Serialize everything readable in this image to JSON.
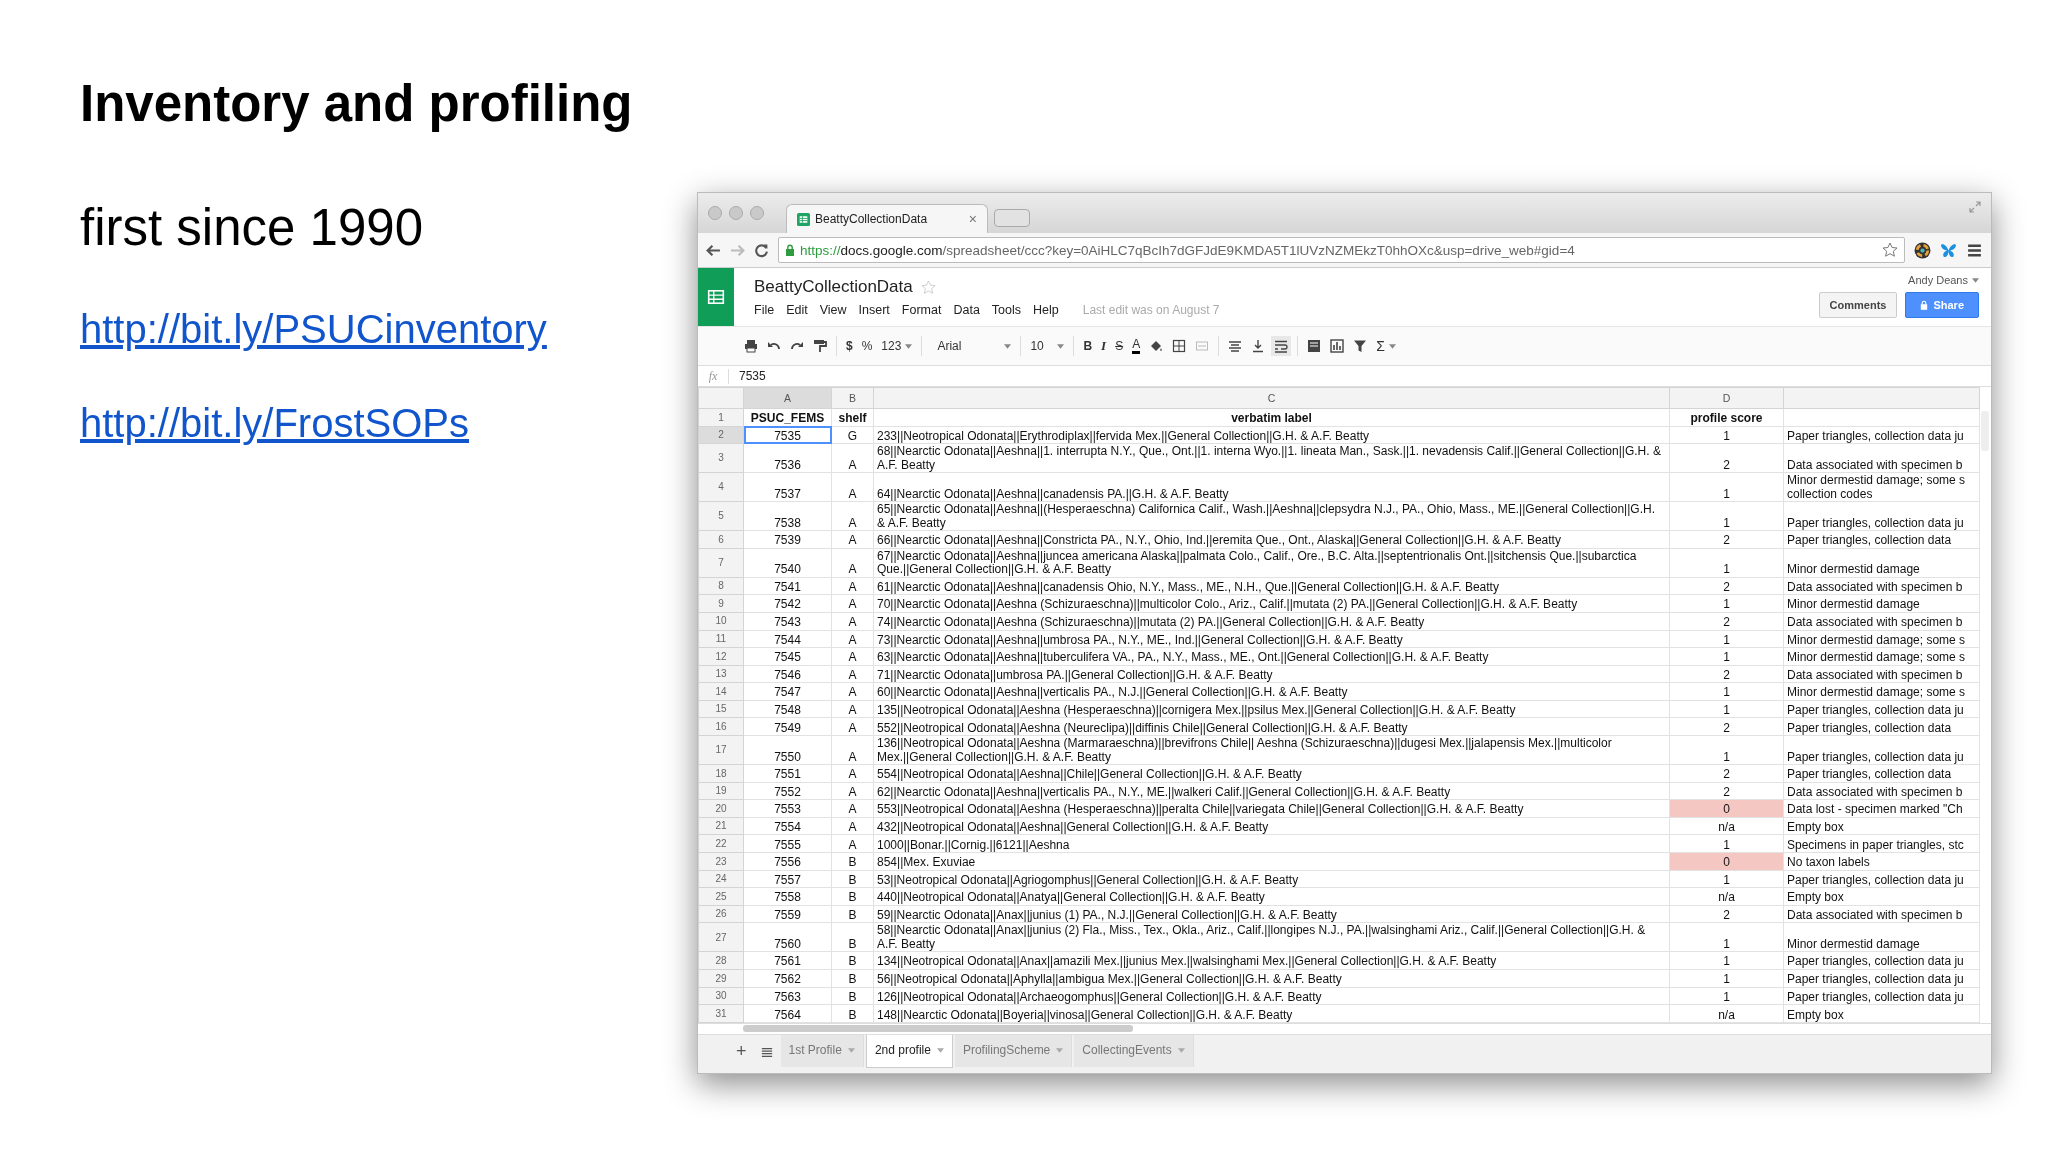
{
  "slide": {
    "title": "Inventory and profiling",
    "subtitle": "first since 1990",
    "links": [
      "http://bit.ly/PSUCinventory",
      "http://bit.ly/FrostSOPs"
    ]
  },
  "browser": {
    "tab_title": "BeattyCollectionData",
    "tab_close": "×",
    "url": {
      "scheme": "https://",
      "host": "docs.google.com",
      "path": "/spreadsheet/ccc?key=0AiHLC7qBcIh7dGFJdE9KMDA5T1lUVzNZMEkzT0hhOXc&usp=drive_web#gid=4"
    }
  },
  "doc": {
    "title": "BeattyCollectionData",
    "menus": [
      "File",
      "Edit",
      "View",
      "Insert",
      "Format",
      "Data",
      "Tools",
      "Help"
    ],
    "last_edit": "Last edit was on August 7",
    "user": "Andy Deans",
    "comments": "Comments",
    "share": "Share"
  },
  "toolbar": {
    "currency": "$",
    "percent": "%",
    "number_format": "123",
    "font": "Arial",
    "font_size": "10",
    "bold": "B",
    "italic": "I",
    "strike": "S",
    "text_color": "A",
    "sum": "Σ"
  },
  "formula_bar": {
    "label": "fx",
    "value": "7535"
  },
  "columns": [
    "A",
    "B",
    "C",
    "D"
  ],
  "header_row": {
    "number": "1",
    "a": "PSUC_FEMS",
    "b": "shelf",
    "c": "verbatim label",
    "d": "profile score"
  },
  "rows": [
    {
      "number": "2",
      "a": "7535",
      "b": "G",
      "c": "233||Neotropical Odonata||Erythrodiplax||fervida Mex.||General Collection||G.H. & A.F. Beatty",
      "d": "1",
      "e": "Paper triangles, collection data ju",
      "flagged": false,
      "selected": true
    },
    {
      "number": "3",
      "a": "7536",
      "b": "A",
      "c": "68||Nearctic Odonata||Aeshna||1. interrupta N.Y., Que., Ont.||1. interna Wyo.||1. lineata Man., Sask.||1. nevadensis Calif.||General Collection||G.H. & A.F. Beatty",
      "d": "2",
      "e": "Data associated with specimen b",
      "flagged": false,
      "selected": false
    },
    {
      "number": "4",
      "a": "7537",
      "b": "A",
      "c": "64||Nearctic Odonata||Aeshna||canadensis PA.||G.H. & A.F. Beatty",
      "d": "1",
      "e": "Minor dermestid damage; some s\ncollection codes",
      "flagged": false,
      "selected": false
    },
    {
      "number": "5",
      "a": "7538",
      "b": "A",
      "c": "65||Nearctic Odonata||Aeshna||(Hesperaeschna) Californica Calif., Wash.||Aeshna||clepsydra N.J., PA., Ohio, Mass., ME.||General Collection||G.H. & A.F. Beatty",
      "d": "1",
      "e": "Paper triangles, collection data ju",
      "flagged": false,
      "selected": false
    },
    {
      "number": "6",
      "a": "7539",
      "b": "A",
      "c": "66||Nearctic Odonata||Aeshna||Constricta PA., N.Y., Ohio, Ind.||eremita Que., Ont., Alaska||General Collection||G.H. & A.F. Beatty",
      "d": "2",
      "e": "Paper triangles, collection data",
      "flagged": false,
      "selected": false
    },
    {
      "number": "7",
      "a": "7540",
      "b": "A",
      "c": "67||Nearctic Odonata||Aeshna||juncea americana Alaska||palmata Colo., Calif., Ore., B.C. Alta.||septentrionalis Ont.||sitchensis Que.||subarctica Que.||General Collection||G.H. & A.F. Beatty",
      "d": "1",
      "e": "Minor dermestid damage",
      "flagged": false,
      "selected": false
    },
    {
      "number": "8",
      "a": "7541",
      "b": "A",
      "c": "61||Nearctic Odonata||Aeshna||canadensis Ohio, N.Y., Mass., ME., N.H., Que.||General Collection||G.H. & A.F. Beatty",
      "d": "2",
      "e": "Data associated with specimen b",
      "flagged": false,
      "selected": false
    },
    {
      "number": "9",
      "a": "7542",
      "b": "A",
      "c": "70||Nearctic Odonata||Aeshna (Schizuraeschna)||multicolor Colo., Ariz., Calif.||mutata (2) PA.||General Collection||G.H. & A.F. Beatty",
      "d": "1",
      "e": "Minor dermestid damage",
      "flagged": false,
      "selected": false
    },
    {
      "number": "10",
      "a": "7543",
      "b": "A",
      "c": "74||Nearctic Odonata||Aeshna (Schizuraeschna)||mutata (2) PA.||General Collection||G.H. & A.F. Beatty",
      "d": "2",
      "e": "Data associated with specimen b",
      "flagged": false,
      "selected": false
    },
    {
      "number": "11",
      "a": "7544",
      "b": "A",
      "c": "73||Nearctic Odonata||Aeshna||umbrosa PA., N.Y., ME., Ind.||General Collection||G.H. & A.F. Beatty",
      "d": "1",
      "e": "Minor dermestid damage; some s",
      "flagged": false,
      "selected": false
    },
    {
      "number": "12",
      "a": "7545",
      "b": "A",
      "c": "63||Nearctic Odonata||Aeshna||tuberculifera VA., PA., N.Y., Mass., ME., Ont.||General Collection||G.H. & A.F. Beatty",
      "d": "1",
      "e": "Minor dermestid damage; some s",
      "flagged": false,
      "selected": false
    },
    {
      "number": "13",
      "a": "7546",
      "b": "A",
      "c": "71||Nearctic Odonata||umbrosa PA.||General Collection||G.H. & A.F. Beatty",
      "d": "2",
      "e": "Data associated with specimen b",
      "flagged": false,
      "selected": false
    },
    {
      "number": "14",
      "a": "7547",
      "b": "A",
      "c": "60||Nearctic Odonata||Aeshna||verticalis PA., N.J.||General Collection||G.H. & A.F. Beatty",
      "d": "1",
      "e": "Minor dermestid damage; some s",
      "flagged": false,
      "selected": false
    },
    {
      "number": "15",
      "a": "7548",
      "b": "A",
      "c": "135||Neotropical Odonata||Aeshna (Hesperaeschna)||cornigera Mex.||psilus Mex.||General Collection||G.H. & A.F. Beatty",
      "d": "1",
      "e": "Paper triangles, collection data ju",
      "flagged": false,
      "selected": false
    },
    {
      "number": "16",
      "a": "7549",
      "b": "A",
      "c": "552||Neotropical Odonata||Aeshna (Neureclipa)||diffinis Chile||General Collection||G.H. & A.F. Beatty",
      "d": "2",
      "e": "Paper triangles, collection data",
      "flagged": false,
      "selected": false
    },
    {
      "number": "17",
      "a": "7550",
      "b": "A",
      "c": "136||Neotropical Odonata||Aeshna (Marmaraeschna)||brevifrons Chile|| Aeshna (Schizuraeschna)||dugesi Mex.||jalapensis Mex.||multicolor Mex.||General Collection||G.H. & A.F. Beatty",
      "d": "1",
      "e": "Paper triangles, collection data ju",
      "flagged": false,
      "selected": false
    },
    {
      "number": "18",
      "a": "7551",
      "b": "A",
      "c": "554||Neotropical Odonata||Aeshna||Chile||General Collection||G.H. & A.F. Beatty",
      "d": "2",
      "e": "Paper triangles, collection data",
      "flagged": false,
      "selected": false
    },
    {
      "number": "19",
      "a": "7552",
      "b": "A",
      "c": "62||Nearctic Odonata||Aeshna||verticalis PA., N.Y., ME.||walkeri Calif.||General Collection||G.H. & A.F. Beatty",
      "d": "2",
      "e": "Data associated with specimen b",
      "flagged": false,
      "selected": false
    },
    {
      "number": "20",
      "a": "7553",
      "b": "A",
      "c": "553||Neotropical Odonata||Aeshna (Hesperaeschna)||peralta Chile||variegata Chile||General Collection||G.H. & A.F. Beatty",
      "d": "0",
      "e": "Data lost - specimen marked \"Ch",
      "flagged": true,
      "selected": false
    },
    {
      "number": "21",
      "a": "7554",
      "b": "A",
      "c": "432||Neotropical Odonata||Aeshna||General Collection||G.H. & A.F. Beatty",
      "d": "n/a",
      "e": "Empty box",
      "flagged": false,
      "selected": false
    },
    {
      "number": "22",
      "a": "7555",
      "b": "A",
      "c": "1000||Bonar.||Cornig.||6121||Aeshna",
      "d": "1",
      "e": "Specimens in paper triangles, stc",
      "flagged": false,
      "selected": false
    },
    {
      "number": "23",
      "a": "7556",
      "b": "B",
      "c": "854||Mex. Exuviae",
      "d": "0",
      "e": "No taxon labels",
      "flagged": true,
      "selected": false
    },
    {
      "number": "24",
      "a": "7557",
      "b": "B",
      "c": "53||Neotropical Odonata||Agriogomphus||General Collection||G.H. & A.F. Beatty",
      "d": "1",
      "e": "Paper triangles, collection data ju",
      "flagged": false,
      "selected": false
    },
    {
      "number": "25",
      "a": "7558",
      "b": "B",
      "c": "440||Neotropical Odonata||Anatya||General Collection||G.H. & A.F. Beatty",
      "d": "n/a",
      "e": "Empty box",
      "flagged": false,
      "selected": false
    },
    {
      "number": "26",
      "a": "7559",
      "b": "B",
      "c": "59||Nearctic Odonata||Anax||junius (1) PA., N.J.||General Collection||G.H. & A.F. Beatty",
      "d": "2",
      "e": "Data associated with specimen b",
      "flagged": false,
      "selected": false
    },
    {
      "number": "27",
      "a": "7560",
      "b": "B",
      "c": "58||Nearctic Odonata||Anax||junius (2) Fla., Miss., Tex., Okla., Ariz., Calif.||longipes N.J., PA.||walsinghami Ariz., Calif.||General Collection||G.H. & A.F. Beatty",
      "d": "1",
      "e": "Minor dermestid damage",
      "flagged": false,
      "selected": false
    },
    {
      "number": "28",
      "a": "7561",
      "b": "B",
      "c": "134||Neotropical Odonata||Anax||amazili Mex.||junius Mex.||walsinghami Mex.||General Collection||G.H. & A.F. Beatty",
      "d": "1",
      "e": "Paper triangles, collection data ju",
      "flagged": false,
      "selected": false
    },
    {
      "number": "29",
      "a": "7562",
      "b": "B",
      "c": "56||Neotropical Odonata||Aphylla||ambigua Mex.||General Collection||G.H. & A.F. Beatty",
      "d": "1",
      "e": "Paper triangles, collection data ju",
      "flagged": false,
      "selected": false
    },
    {
      "number": "30",
      "a": "7563",
      "b": "B",
      "c": "126||Neotropical Odonata||Archaeogomphus||General Collection||G.H. & A.F. Beatty",
      "d": "1",
      "e": "Paper triangles, collection data ju",
      "flagged": false,
      "selected": false
    },
    {
      "number": "31",
      "a": "7564",
      "b": "B",
      "c": "148||Nearctic Odonata||Boyeria||vinosa||General Collection||G.H. & A.F. Beatty",
      "d": "n/a",
      "e": "Empty box",
      "flagged": false,
      "selected": false
    }
  ],
  "sheet_tabs": [
    {
      "label": "1st Profile",
      "selected": false
    },
    {
      "label": "2nd profile",
      "selected": true
    },
    {
      "label": "ProfilingScheme",
      "selected": false
    },
    {
      "label": "CollectingEvents",
      "selected": false
    }
  ],
  "add_sheet": "+"
}
